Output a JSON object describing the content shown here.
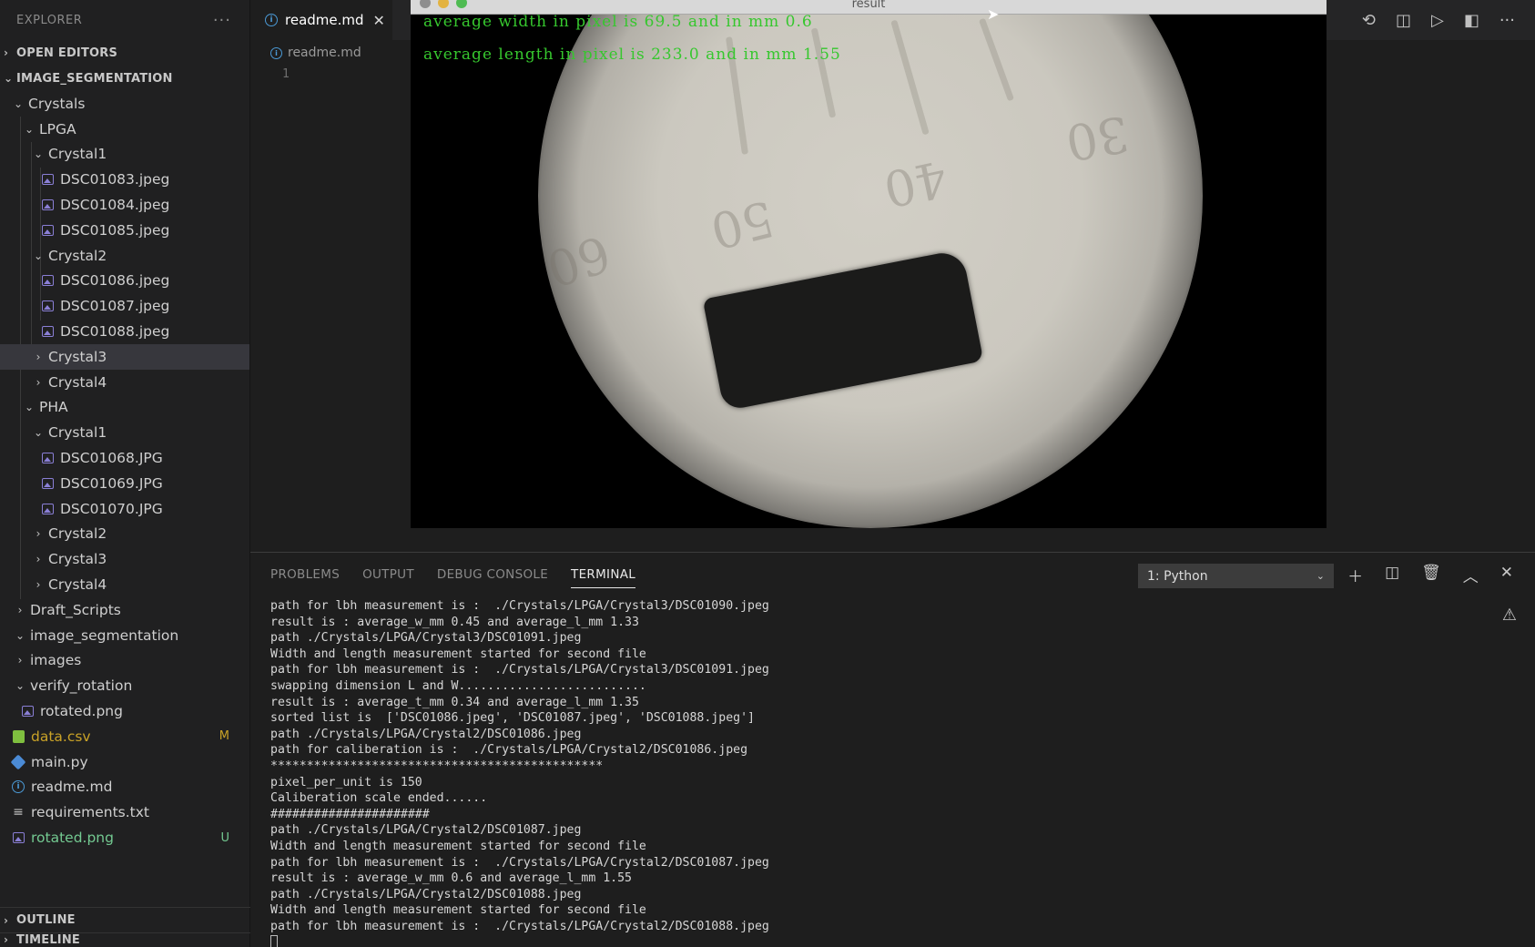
{
  "sidebar": {
    "header": "EXPLORER",
    "more": "···",
    "open_editors": "OPEN EDITORS",
    "workspace": "IMAGE_SEGMENTATION",
    "outline": "OUTLINE",
    "timeline": "TIMELINE",
    "tree": [
      {
        "label": "Crystals"
      },
      {
        "label": "LPGA"
      },
      {
        "label": "Crystal1"
      },
      {
        "label": "DSC01083.jpeg"
      },
      {
        "label": "DSC01084.jpeg"
      },
      {
        "label": "DSC01085.jpeg"
      },
      {
        "label": "Crystal2"
      },
      {
        "label": "DSC01086.jpeg"
      },
      {
        "label": "DSC01087.jpeg"
      },
      {
        "label": "DSC01088.jpeg"
      },
      {
        "label": "Crystal3"
      },
      {
        "label": "Crystal4"
      },
      {
        "label": "PHA"
      },
      {
        "label": "Crystal1"
      },
      {
        "label": "DSC01068.JPG"
      },
      {
        "label": "DSC01069.JPG"
      },
      {
        "label": "DSC01070.JPG"
      },
      {
        "label": "Crystal2"
      },
      {
        "label": "Crystal3"
      },
      {
        "label": "Crystal4"
      },
      {
        "label": "Draft_Scripts"
      },
      {
        "label": "image_segmentation"
      },
      {
        "label": "images"
      },
      {
        "label": "verify_rotation"
      },
      {
        "label": "rotated.png"
      },
      {
        "label": "data.csv",
        "badge": "M"
      },
      {
        "label": "main.py"
      },
      {
        "label": "readme.md"
      },
      {
        "label": "requirements.txt"
      },
      {
        "label": "rotated.png",
        "badge": "U"
      }
    ]
  },
  "editor": {
    "tab_label": "readme.md",
    "breadcrumb": "readme.md",
    "line_number": "1"
  },
  "result_window": {
    "title": "result",
    "line1": "average width in pixel is 69.5 and in mm 0.6",
    "line2": "average length in pixel is 233.0 and in mm 1.55",
    "scale_labels": [
      "60",
      "50",
      "40",
      "30"
    ]
  },
  "panel": {
    "tabs": [
      "PROBLEMS",
      "OUTPUT",
      "DEBUG CONSOLE",
      "TERMINAL"
    ],
    "terminal_select": "1: Python",
    "terminal_lines": [
      "path for lbh measurement is :  ./Crystals/LPGA/Crystal3/DSC01090.jpeg",
      "result is : average_w_mm 0.45 and average_l_mm 1.33",
      "path ./Crystals/LPGA/Crystal3/DSC01091.jpeg",
      "Width and length measurement started for second file",
      "path for lbh measurement is :  ./Crystals/LPGA/Crystal3/DSC01091.jpeg",
      "swapping dimension L and W..........................",
      "result is : average_t_mm 0.34 and average_l_mm 1.35",
      "sorted list is  ['DSC01086.jpeg', 'DSC01087.jpeg', 'DSC01088.jpeg']",
      "path ./Crystals/LPGA/Crystal2/DSC01086.jpeg",
      "path for caliberation is :  ./Crystals/LPGA/Crystal2/DSC01086.jpeg",
      "**********************************************",
      "pixel_per_unit is 150",
      "Caliberation scale ended......",
      "######################",
      "path ./Crystals/LPGA/Crystal2/DSC01087.jpeg",
      "Width and length measurement started for second file",
      "path for lbh measurement is :  ./Crystals/LPGA/Crystal2/DSC01087.jpeg",
      "result is : average_w_mm 0.6 and average_l_mm 1.55",
      "path ./Crystals/LPGA/Crystal2/DSC01088.jpeg",
      "Width and length measurement started for second file",
      "path for lbh measurement is :  ./Crystals/LPGA/Crystal2/DSC01088.jpeg"
    ]
  },
  "colors": {
    "overlay_text": "#36c72e",
    "badge_modified": "#c9a227",
    "badge_untracked": "#73c991",
    "selection": "#37373d"
  }
}
